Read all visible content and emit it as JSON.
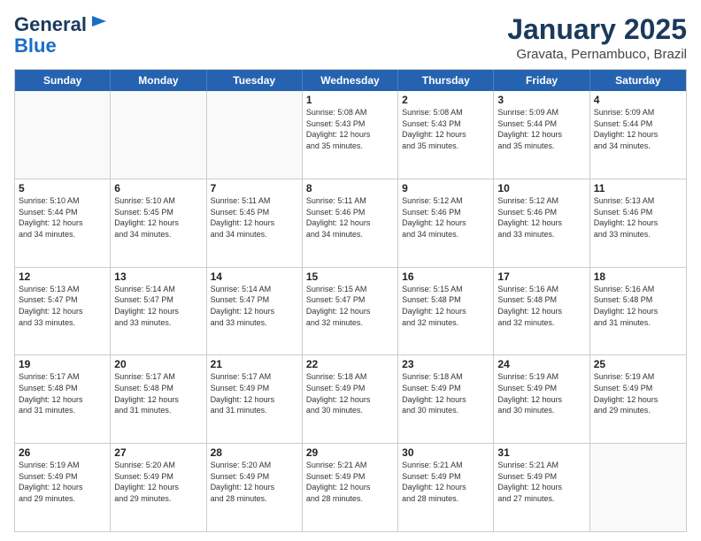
{
  "header": {
    "logo_general": "General",
    "logo_blue": "Blue",
    "month_year": "January 2025",
    "location": "Gravata, Pernambuco, Brazil"
  },
  "weekdays": [
    "Sunday",
    "Monday",
    "Tuesday",
    "Wednesday",
    "Thursday",
    "Friday",
    "Saturday"
  ],
  "rows": [
    [
      {
        "day": "",
        "lines": []
      },
      {
        "day": "",
        "lines": []
      },
      {
        "day": "",
        "lines": []
      },
      {
        "day": "1",
        "lines": [
          "Sunrise: 5:08 AM",
          "Sunset: 5:43 PM",
          "Daylight: 12 hours",
          "and 35 minutes."
        ]
      },
      {
        "day": "2",
        "lines": [
          "Sunrise: 5:08 AM",
          "Sunset: 5:43 PM",
          "Daylight: 12 hours",
          "and 35 minutes."
        ]
      },
      {
        "day": "3",
        "lines": [
          "Sunrise: 5:09 AM",
          "Sunset: 5:44 PM",
          "Daylight: 12 hours",
          "and 35 minutes."
        ]
      },
      {
        "day": "4",
        "lines": [
          "Sunrise: 5:09 AM",
          "Sunset: 5:44 PM",
          "Daylight: 12 hours",
          "and 34 minutes."
        ]
      }
    ],
    [
      {
        "day": "5",
        "lines": [
          "Sunrise: 5:10 AM",
          "Sunset: 5:44 PM",
          "Daylight: 12 hours",
          "and 34 minutes."
        ]
      },
      {
        "day": "6",
        "lines": [
          "Sunrise: 5:10 AM",
          "Sunset: 5:45 PM",
          "Daylight: 12 hours",
          "and 34 minutes."
        ]
      },
      {
        "day": "7",
        "lines": [
          "Sunrise: 5:11 AM",
          "Sunset: 5:45 PM",
          "Daylight: 12 hours",
          "and 34 minutes."
        ]
      },
      {
        "day": "8",
        "lines": [
          "Sunrise: 5:11 AM",
          "Sunset: 5:46 PM",
          "Daylight: 12 hours",
          "and 34 minutes."
        ]
      },
      {
        "day": "9",
        "lines": [
          "Sunrise: 5:12 AM",
          "Sunset: 5:46 PM",
          "Daylight: 12 hours",
          "and 34 minutes."
        ]
      },
      {
        "day": "10",
        "lines": [
          "Sunrise: 5:12 AM",
          "Sunset: 5:46 PM",
          "Daylight: 12 hours",
          "and 33 minutes."
        ]
      },
      {
        "day": "11",
        "lines": [
          "Sunrise: 5:13 AM",
          "Sunset: 5:46 PM",
          "Daylight: 12 hours",
          "and 33 minutes."
        ]
      }
    ],
    [
      {
        "day": "12",
        "lines": [
          "Sunrise: 5:13 AM",
          "Sunset: 5:47 PM",
          "Daylight: 12 hours",
          "and 33 minutes."
        ]
      },
      {
        "day": "13",
        "lines": [
          "Sunrise: 5:14 AM",
          "Sunset: 5:47 PM",
          "Daylight: 12 hours",
          "and 33 minutes."
        ]
      },
      {
        "day": "14",
        "lines": [
          "Sunrise: 5:14 AM",
          "Sunset: 5:47 PM",
          "Daylight: 12 hours",
          "and 33 minutes."
        ]
      },
      {
        "day": "15",
        "lines": [
          "Sunrise: 5:15 AM",
          "Sunset: 5:47 PM",
          "Daylight: 12 hours",
          "and 32 minutes."
        ]
      },
      {
        "day": "16",
        "lines": [
          "Sunrise: 5:15 AM",
          "Sunset: 5:48 PM",
          "Daylight: 12 hours",
          "and 32 minutes."
        ]
      },
      {
        "day": "17",
        "lines": [
          "Sunrise: 5:16 AM",
          "Sunset: 5:48 PM",
          "Daylight: 12 hours",
          "and 32 minutes."
        ]
      },
      {
        "day": "18",
        "lines": [
          "Sunrise: 5:16 AM",
          "Sunset: 5:48 PM",
          "Daylight: 12 hours",
          "and 31 minutes."
        ]
      }
    ],
    [
      {
        "day": "19",
        "lines": [
          "Sunrise: 5:17 AM",
          "Sunset: 5:48 PM",
          "Daylight: 12 hours",
          "and 31 minutes."
        ]
      },
      {
        "day": "20",
        "lines": [
          "Sunrise: 5:17 AM",
          "Sunset: 5:48 PM",
          "Daylight: 12 hours",
          "and 31 minutes."
        ]
      },
      {
        "day": "21",
        "lines": [
          "Sunrise: 5:17 AM",
          "Sunset: 5:49 PM",
          "Daylight: 12 hours",
          "and 31 minutes."
        ]
      },
      {
        "day": "22",
        "lines": [
          "Sunrise: 5:18 AM",
          "Sunset: 5:49 PM",
          "Daylight: 12 hours",
          "and 30 minutes."
        ]
      },
      {
        "day": "23",
        "lines": [
          "Sunrise: 5:18 AM",
          "Sunset: 5:49 PM",
          "Daylight: 12 hours",
          "and 30 minutes."
        ]
      },
      {
        "day": "24",
        "lines": [
          "Sunrise: 5:19 AM",
          "Sunset: 5:49 PM",
          "Daylight: 12 hours",
          "and 30 minutes."
        ]
      },
      {
        "day": "25",
        "lines": [
          "Sunrise: 5:19 AM",
          "Sunset: 5:49 PM",
          "Daylight: 12 hours",
          "and 29 minutes."
        ]
      }
    ],
    [
      {
        "day": "26",
        "lines": [
          "Sunrise: 5:19 AM",
          "Sunset: 5:49 PM",
          "Daylight: 12 hours",
          "and 29 minutes."
        ]
      },
      {
        "day": "27",
        "lines": [
          "Sunrise: 5:20 AM",
          "Sunset: 5:49 PM",
          "Daylight: 12 hours",
          "and 29 minutes."
        ]
      },
      {
        "day": "28",
        "lines": [
          "Sunrise: 5:20 AM",
          "Sunset: 5:49 PM",
          "Daylight: 12 hours",
          "and 28 minutes."
        ]
      },
      {
        "day": "29",
        "lines": [
          "Sunrise: 5:21 AM",
          "Sunset: 5:49 PM",
          "Daylight: 12 hours",
          "and 28 minutes."
        ]
      },
      {
        "day": "30",
        "lines": [
          "Sunrise: 5:21 AM",
          "Sunset: 5:49 PM",
          "Daylight: 12 hours",
          "and 28 minutes."
        ]
      },
      {
        "day": "31",
        "lines": [
          "Sunrise: 5:21 AM",
          "Sunset: 5:49 PM",
          "Daylight: 12 hours",
          "and 27 minutes."
        ]
      },
      {
        "day": "",
        "lines": []
      }
    ]
  ]
}
